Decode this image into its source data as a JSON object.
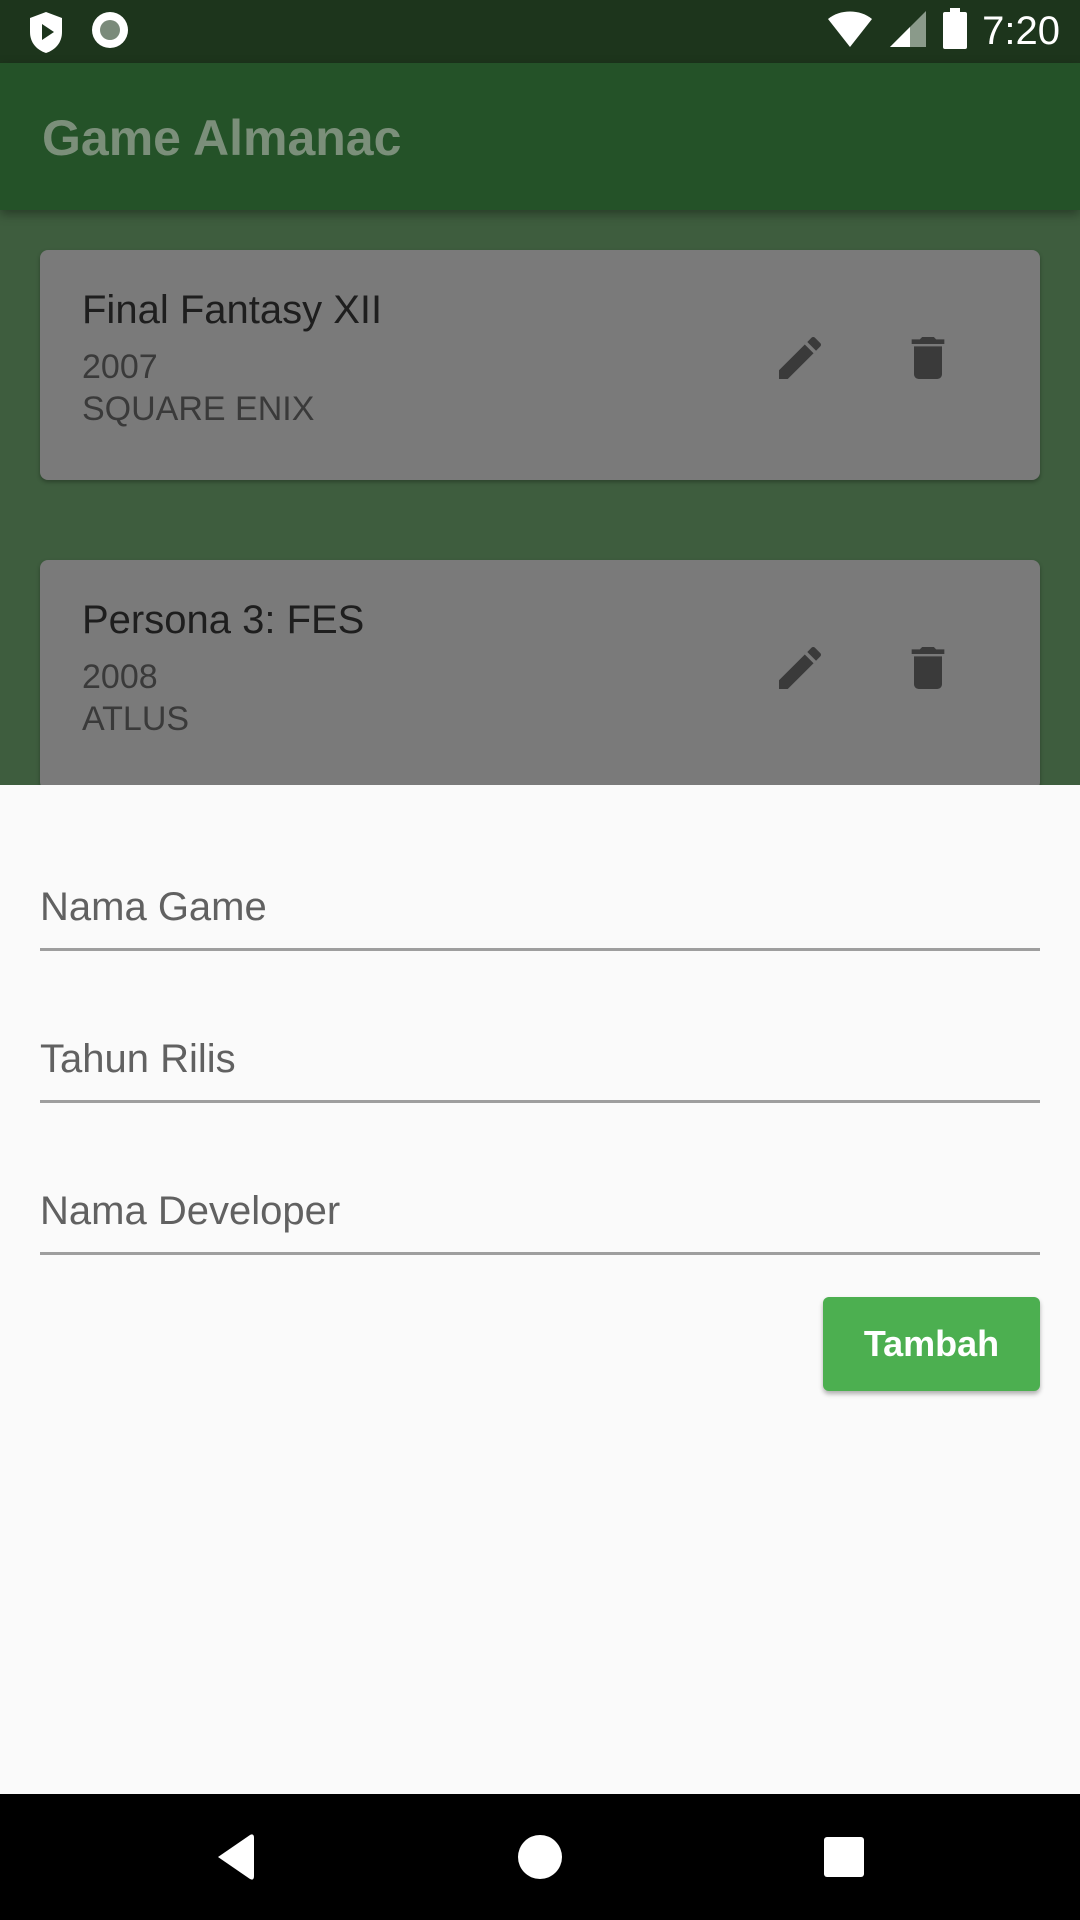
{
  "status_bar": {
    "time": "7:20",
    "icons": [
      "play-shield-icon",
      "record-circle-icon",
      "wifi-icon",
      "cellular-signal-icon",
      "battery-icon"
    ]
  },
  "app_bar": {
    "title": "Game Almanac"
  },
  "games": [
    {
      "title": "Final Fantasy XII",
      "year": "2007",
      "developer": "SQUARE ENIX"
    },
    {
      "title": "Persona 3: FES",
      "year": "2008",
      "developer": "ATLUS"
    }
  ],
  "form": {
    "name_placeholder": "Nama Game",
    "year_placeholder": "Tahun Rilis",
    "developer_placeholder": "Nama Developer",
    "submit_label": "Tambah"
  },
  "colors": {
    "primary": "#245228",
    "accent": "#4caf50",
    "scrim_list": "#3e5d3e",
    "card": "#7a7a7a"
  }
}
